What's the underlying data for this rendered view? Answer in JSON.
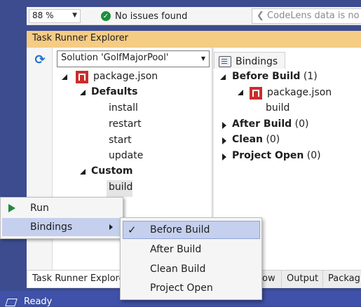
{
  "editor_bar": {
    "zoom": "88 %",
    "status": "No issues found",
    "codelens": "CodeLens data is no"
  },
  "task_runner": {
    "title": "Task Runner Explorer",
    "solution": "Solution 'GolfMajorPool'",
    "tree": {
      "root": "package.json",
      "defaults_label": "Defaults",
      "defaults": [
        "install",
        "restart",
        "start",
        "update"
      ],
      "custom_label": "Custom",
      "custom": [
        "build"
      ]
    },
    "bindings": {
      "tab": "Bindings",
      "groups": [
        {
          "name": "Before Build",
          "count": "(1)",
          "expanded": true,
          "file": "package.json",
          "task": "build"
        },
        {
          "name": "After Build",
          "count": "(0)",
          "expanded": false
        },
        {
          "name": "Clean",
          "count": "(0)",
          "expanded": false
        },
        {
          "name": "Project Open",
          "count": "(0)",
          "expanded": false
        }
      ]
    }
  },
  "bottom_tabs": [
    "Task Runner Explorer",
    "ow",
    "Output",
    "Packag"
  ],
  "status_bar": {
    "text": "Ready"
  },
  "context_menu": {
    "run": "Run",
    "bindings": "Bindings",
    "submenu": [
      {
        "label": "Before Build",
        "checked": true
      },
      {
        "label": "After Build",
        "checked": false
      },
      {
        "label": "Clean Build",
        "checked": false
      },
      {
        "label": "Project Open",
        "checked": false
      }
    ]
  }
}
